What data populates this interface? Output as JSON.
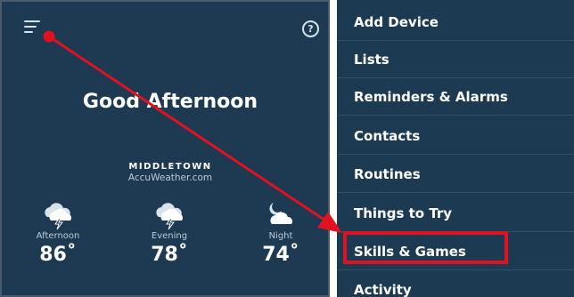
{
  "header": {
    "menu_icon": "hamburger-menu-icon",
    "help_icon": "help-circle-icon",
    "help_glyph": "?"
  },
  "greeting": "Good Afternoon",
  "weather": {
    "location": "MIDDLETOWN",
    "source": "AccuWeather.com",
    "forecast": [
      {
        "period": "Afternoon",
        "temp": "86˚",
        "icon": "thunderstorm-cloud-icon"
      },
      {
        "period": "Evening",
        "temp": "78˚",
        "icon": "thunderstorm-cloud-icon"
      },
      {
        "period": "Night",
        "temp": "74˚",
        "icon": "moon-cloud-icon"
      }
    ]
  },
  "menu": {
    "items": [
      {
        "label": "Add Device"
      },
      {
        "label": "Lists"
      },
      {
        "label": "Reminders & Alarms"
      },
      {
        "label": "Contacts"
      },
      {
        "label": "Routines"
      },
      {
        "label": "Things to Try"
      },
      {
        "label": "Skills & Games",
        "highlighted": true
      },
      {
        "label": "Activity"
      }
    ]
  },
  "colors": {
    "panel_bg": "#1d3a52",
    "text": "#ffffff",
    "muted_text": "#b9cbd8",
    "annotation_red": "#e0121f"
  }
}
